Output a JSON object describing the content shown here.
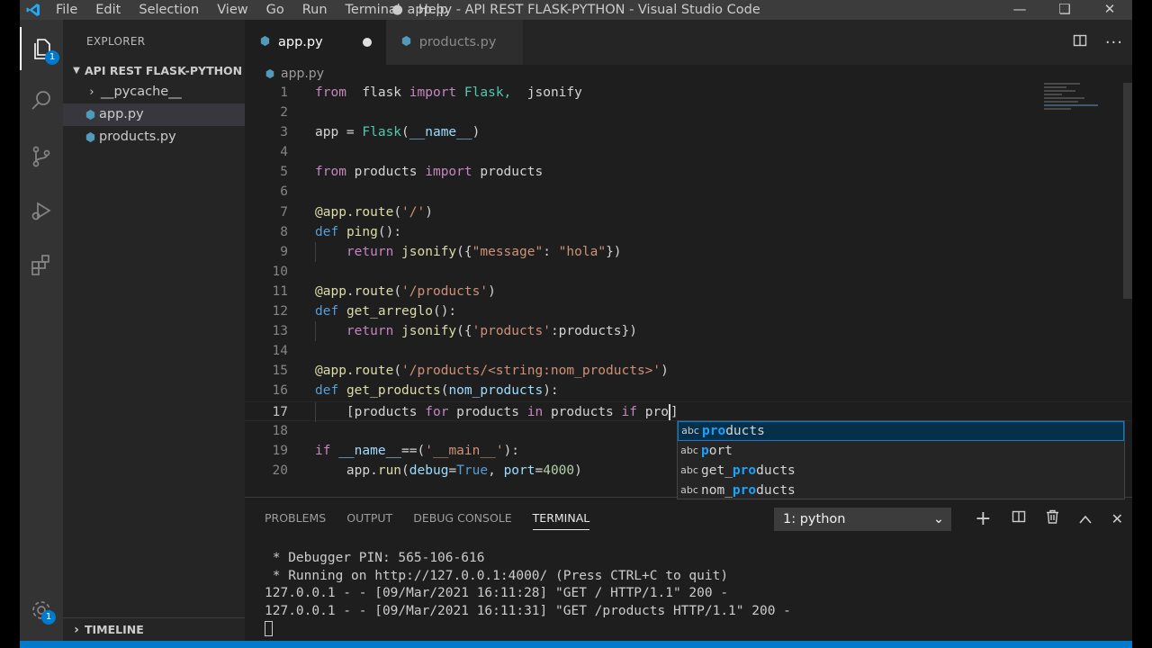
{
  "window": {
    "title": "● app.py - API REST FLASK-PYTHON - Visual Studio Code",
    "menu": [
      "File",
      "Edit",
      "Selection",
      "View",
      "Go",
      "Run",
      "Terminal",
      "Help"
    ]
  },
  "activity": {
    "explorer_badge": "1",
    "settings_badge": "1"
  },
  "sidebar": {
    "header": "EXPLORER",
    "project": "API REST FLASK-PYTHON",
    "items": [
      {
        "label": "__pycache__"
      },
      {
        "label": "app.py"
      },
      {
        "label": "products.py"
      }
    ],
    "timeline": "TIMELINE"
  },
  "tabs": [
    {
      "label": "app.py"
    },
    {
      "label": "products.py"
    }
  ],
  "breadcrumb": "app.py",
  "code": {
    "line_numbers": [
      "1",
      "2",
      "3",
      "4",
      "5",
      "6",
      "7",
      "8",
      "9",
      "10",
      "11",
      "12",
      "13",
      "14",
      "15",
      "16",
      "17",
      "18",
      "19",
      "20"
    ],
    "lines": {
      "l1": {
        "a": "from",
        "b": "flask",
        "c": "import",
        "d": "Flask,",
        "e": "jsonify"
      },
      "l3": {
        "a": "app = ",
        "b": "Flask",
        "c": "(",
        "d": "__name__",
        "e": ")"
      },
      "l5": {
        "a": "from",
        "b": " products ",
        "c": "import",
        "d": " products"
      },
      "l7": {
        "a": "@app.route",
        "b": "(",
        "c": "'/'",
        "d": ")"
      },
      "l8": {
        "a": "def",
        "b": "ping",
        "c": "():"
      },
      "l9": {
        "a": "return",
        "b": "jsonify",
        "c": "({",
        "d": "\"message\"",
        "e": ": ",
        "f": "\"hola\"",
        "g": "})"
      },
      "l11": {
        "a": "@app.route",
        "b": "(",
        "c": "'/products'",
        "d": ")"
      },
      "l12": {
        "a": "def",
        "b": "get_arreglo",
        "c": "():"
      },
      "l13": {
        "a": "return",
        "b": "jsonify",
        "c": "({",
        "d": "'products'",
        "e": ":products})"
      },
      "l15": {
        "a": "@app.route",
        "b": "(",
        "c": "'/products/<string:nom_products>'",
        "d": ")"
      },
      "l16": {
        "a": "def",
        "b": "get_products",
        "c": "(",
        "d": "nom_products",
        "e": "):"
      },
      "l17": {
        "a": "[",
        "b": "products ",
        "c": "for",
        "d": " products ",
        "e": "in",
        "f": " products ",
        "g": "if",
        "h": " pro",
        "i": "]"
      },
      "l19": {
        "a": "if",
        "b": " __name__",
        "c": "==(",
        "d": "'__main__'",
        "e": "):"
      },
      "l20": {
        "a": "app.",
        "b": "run",
        "c": "(",
        "d": "debug",
        "e": "=",
        "f": "True",
        "g": ", ",
        "h": "port",
        "i": "=",
        "j": "4000",
        "k": ")"
      }
    }
  },
  "suggest": {
    "items": [
      {
        "kind": "abc",
        "hl": "pro",
        "rest": "ducts"
      },
      {
        "kind": "abc",
        "hl": "p",
        "rest": "ort",
        "extra": ""
      },
      {
        "kind": "abc",
        "pre": "get_",
        "hl": "pro",
        "rest": "ducts"
      },
      {
        "kind": "abc",
        "pre": "nom_",
        "hl": "pro",
        "rest": "ducts"
      }
    ]
  },
  "panel": {
    "tabs": [
      "PROBLEMS",
      "OUTPUT",
      "DEBUG CONSOLE",
      "TERMINAL"
    ],
    "terminal_select": "1: python",
    "terminal_lines": [
      " * Debugger PIN: 565-106-616",
      " * Running on http://127.0.0.1:4000/ (Press CTRL+C to quit)",
      "127.0.0.1 - - [09/Mar/2021 16:11:28] \"GET / HTTP/1.1\" 200 -",
      "127.0.0.1 - - [09/Mar/2021 16:11:31] \"GET /products HTTP/1.1\" 200 -"
    ]
  },
  "colors": {
    "accent": "#007acc",
    "keyword": "#569cd6",
    "control": "#c586c0",
    "string": "#ce9178",
    "function": "#dcdcaa"
  }
}
